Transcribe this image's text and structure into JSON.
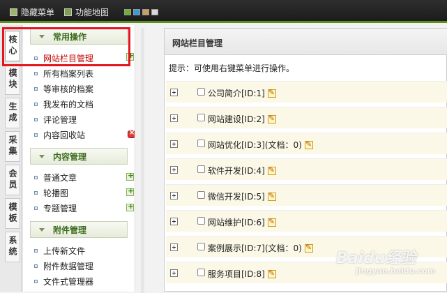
{
  "topbar": {
    "hide_menu": "隐藏菜单",
    "function_map": "功能地图",
    "swatch_colors": [
      "#6fb02f",
      "#3a9ad9",
      "#c8a060",
      "#d9d9d9"
    ]
  },
  "tabs": [
    {
      "label": "核心",
      "active": true
    },
    {
      "label": "模块"
    },
    {
      "label": "生成"
    },
    {
      "label": "采集"
    },
    {
      "label": "会员"
    },
    {
      "label": "模板"
    },
    {
      "label": "系统"
    }
  ],
  "sections": {
    "common": "常用操作",
    "content": "内容管理",
    "attachment": "附件管理"
  },
  "menu": {
    "common_items": [
      "网站栏目管理",
      "所有档案列表",
      "等审核的档案",
      "我发布的文档",
      "评论管理",
      "内容回收站"
    ],
    "content_items": [
      "普通文章",
      "轮播图",
      "专题管理"
    ],
    "attachment_items": [
      "上传新文件",
      "附件数据管理",
      "文件式管理器"
    ]
  },
  "main": {
    "title": "网站栏目管理",
    "hint": "提示：可使用右键菜单进行操作。",
    "rows": [
      "公司简介[ID:1]",
      "网站建设[ID:2]",
      "网站优化[ID:3](文档：0)",
      "软件开发[ID:4]",
      "微信开发[ID:5]",
      "网站维护[ID:6]",
      "案例展示[ID:7](文档：0)",
      "服务项目[ID:8]"
    ]
  },
  "watermark": {
    "brand": "Baidu经验",
    "url": "jingyan.baidu.com"
  },
  "colors": {
    "accent_green": "#5e8f1e",
    "highlight_red": "#e4141e",
    "active_item": "#c20000"
  }
}
